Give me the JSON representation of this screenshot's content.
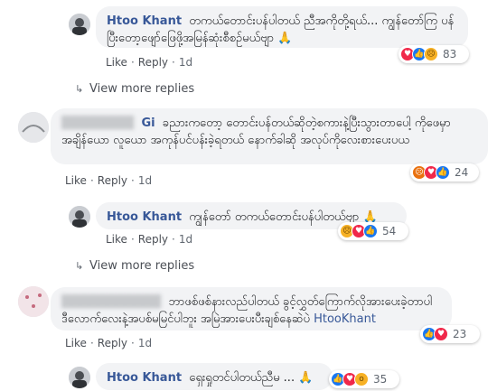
{
  "comments": [
    {
      "id": "c1",
      "author": "Htoo Khant",
      "text": "တကယ်တောင်းပန်ပါတယ် ညီအကိုတို့ရယ်... ကျွန်တော်ကြ ပန်ပြီးတော့ဖျော်ဖြေဖို့အမြန်ဆုံးစီစဉ်မယ်ဗျာ 🙏",
      "like": "Like",
      "reply": "Reply",
      "time": "1d",
      "reaction_count": "83"
    },
    {
      "id": "c2",
      "author": "Gi",
      "text": "ခညားကတော့ တောင်းပန်တယ်ဆိုတဲ့စကားနဲ့ပြီးသွားတာပေါ့ ကိုဖေမှာ အချိန်ယော လူယော အကုန်ပင်ပန်းခဲ့ရတယ် နောက်ခါဆို အလုပ်ကိုလေးစားပေးပယ",
      "like": "Like",
      "reply": "Reply",
      "time": "1d",
      "reaction_count": "24"
    },
    {
      "id": "c3",
      "author": "Htoo Khant",
      "text": "ကျွန်တော် တကယ်တောင်းပန်ပါတယ်ဗျာ 🙏",
      "like": "Like",
      "reply": "Reply",
      "time": "1d",
      "reaction_count": "54"
    },
    {
      "id": "c4",
      "author": "N",
      "text_pre": "ဘာဖစ်ဖစ်နားလည်ပါတယ် ခွင့်လွှတ်ကြောက်လိုအားပေးခဲ့တာပါ ဒီလောက်လေးနဲ့အပစ်မမြင်ပါဘူး အမြဲအားပေးပီးချစ်နေဆဲပဲ",
      "mention": "HtooKhant",
      "like": "Like",
      "reply": "Reply",
      "time": "1d",
      "reaction_count": "23"
    },
    {
      "id": "c5",
      "author": "Htoo Khant",
      "text": "ရှေးရှုတင်ပါတယ်ညီမ ... 🙏",
      "reaction_count": "35"
    }
  ],
  "view_more": [
    "View more replies",
    "View more replies"
  ],
  "colors": {
    "link": "#385898",
    "bubble": "#f2f3f5",
    "meta": "#606770"
  },
  "icons": {
    "avatar": "profile-photo",
    "reply_arrow": "reply-arrow-icon",
    "like": "like-reaction-icon",
    "love": "love-reaction-icon",
    "sad": "sad-reaction-icon",
    "angry": "angry-reaction-icon",
    "wow": "wow-reaction-icon"
  }
}
